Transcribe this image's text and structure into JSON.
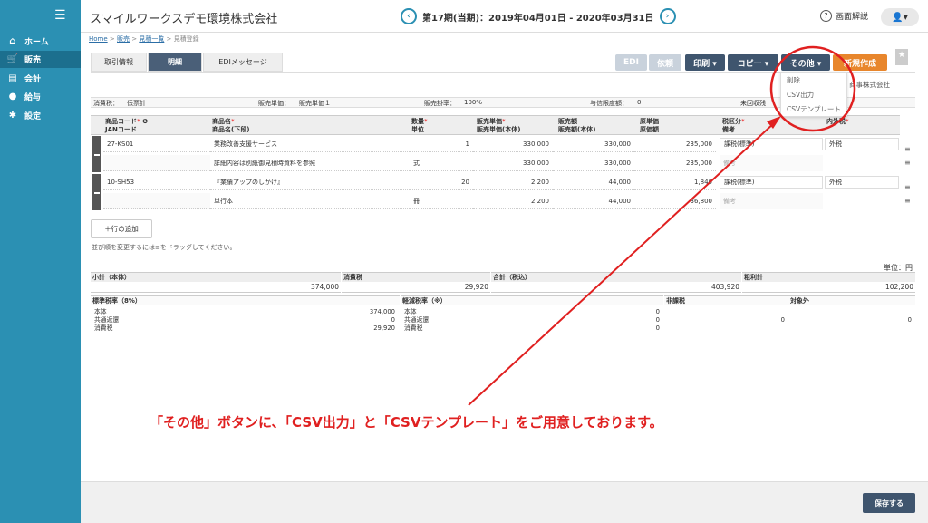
{
  "sidebar": {
    "menu_icon": "hamburger-icon",
    "items": [
      {
        "label": "ホーム",
        "icon": "home-icon"
      },
      {
        "label": "販売",
        "icon": "cart-icon"
      },
      {
        "label": "会計",
        "icon": "ledger-icon"
      },
      {
        "label": "給与",
        "icon": "moneybag-icon"
      },
      {
        "label": "設定",
        "icon": "gear-icon"
      }
    ],
    "active_color": "#1c6f8e",
    "bg_color": "#2b90b3"
  },
  "header": {
    "company": "スマイルワークスデモ環境株式会社",
    "period": "第17期(当期)：2019年04月01日 - 2020年03月31日",
    "help": "画面解説"
  },
  "breadcrumb": [
    "Home",
    "販売",
    "見積一覧",
    "見積登録"
  ],
  "tabs": [
    "取引情報",
    "明細",
    "EDIメッセージ"
  ],
  "toolbar": {
    "edi": "EDI",
    "request": "依頼",
    "print": "印刷 ▾",
    "copy": "コピー ▾",
    "other": "その他 ▾",
    "new": "新規作成"
  },
  "dropdown": [
    "削除",
    "CSV出力",
    "CSVテンプレート"
  ],
  "behind_text": "商事株式会社",
  "info": {
    "tax": "消費税：",
    "tax_val": "伝票計",
    "price": "販売単価：",
    "price_val": "販売単価１",
    "rate": "販売掛率：",
    "rate_val": "100%",
    "credit": "与信限度額：",
    "credit_val": "0",
    "unpaid": "未回収残"
  },
  "table": {
    "headers": {
      "code": "商品コード",
      "jan": "JANコード",
      "name": "商品名",
      "name2": "商品名(下段)",
      "qty": "数量",
      "unit": "単位",
      "price": "販売単価",
      "price2": "販売単価(本体)",
      "amount": "販売額",
      "amount2": "販売額(本体)",
      "cost": "原単価",
      "cost2": "原価額",
      "taxcls": "税区分",
      "memo": "備考",
      "inner": "内外税"
    },
    "rows": [
      {
        "code": "27-KS01",
        "name": "業務改善支援サービス",
        "qty": "1",
        "price": "330,000",
        "amount": "330,000",
        "cost": "235,000",
        "taxcls": "課税(標準)",
        "inner": "外税",
        "name2": "詳細内容は別紙御見積時資料を参照",
        "unit": "式",
        "price2": "330,000",
        "amount2": "330,000",
        "cost2": "235,000",
        "memo": "備考"
      },
      {
        "code": "10-SH53",
        "name": "『業績アップのしかけ』",
        "qty": "20",
        "price": "2,200",
        "amount": "44,000",
        "cost": "1,840",
        "taxcls": "課税(標準)",
        "inner": "外税",
        "name2": "単行本",
        "unit": "冊",
        "price2": "2,200",
        "amount2": "44,000",
        "cost2": "36,800",
        "memo": "備考"
      }
    ]
  },
  "add_row": "＋行の追加",
  "hint": "並び順を変更するには≡をドラッグしてください。",
  "unit_label": "単位：円",
  "totals": {
    "subtotal_label": "小計（本体）",
    "subtotal": "374,000",
    "tax_label": "消費税",
    "tax": "29,920",
    "total_label": "合計（税込）",
    "total": "403,920",
    "gross_label": "粗利計",
    "gross": "102,200"
  },
  "tax_breakdown": {
    "standard": {
      "title": "標準税率（8%）",
      "lines": [
        "本体",
        "共通返還",
        "消費税"
      ],
      "values": [
        "374,000",
        "0",
        "29,920"
      ]
    },
    "reduced": {
      "title": "軽減税率（※）",
      "lines": [
        "本体",
        "共通返還",
        "消費税"
      ],
      "values": [
        "0",
        "0",
        "0"
      ]
    },
    "exempt": {
      "title": "非課税",
      "value": "0"
    },
    "outside": {
      "title": "対象外",
      "value": "0"
    }
  },
  "annotation": "「その他」ボタンに、「CSV出力」と「CSVテンプレート」をご用意しております。",
  "save": "保存する",
  "colors": {
    "accent": "#2b90b3",
    "dark": "#3f556e",
    "orange": "#e8862c",
    "annotation": "#e02020"
  }
}
